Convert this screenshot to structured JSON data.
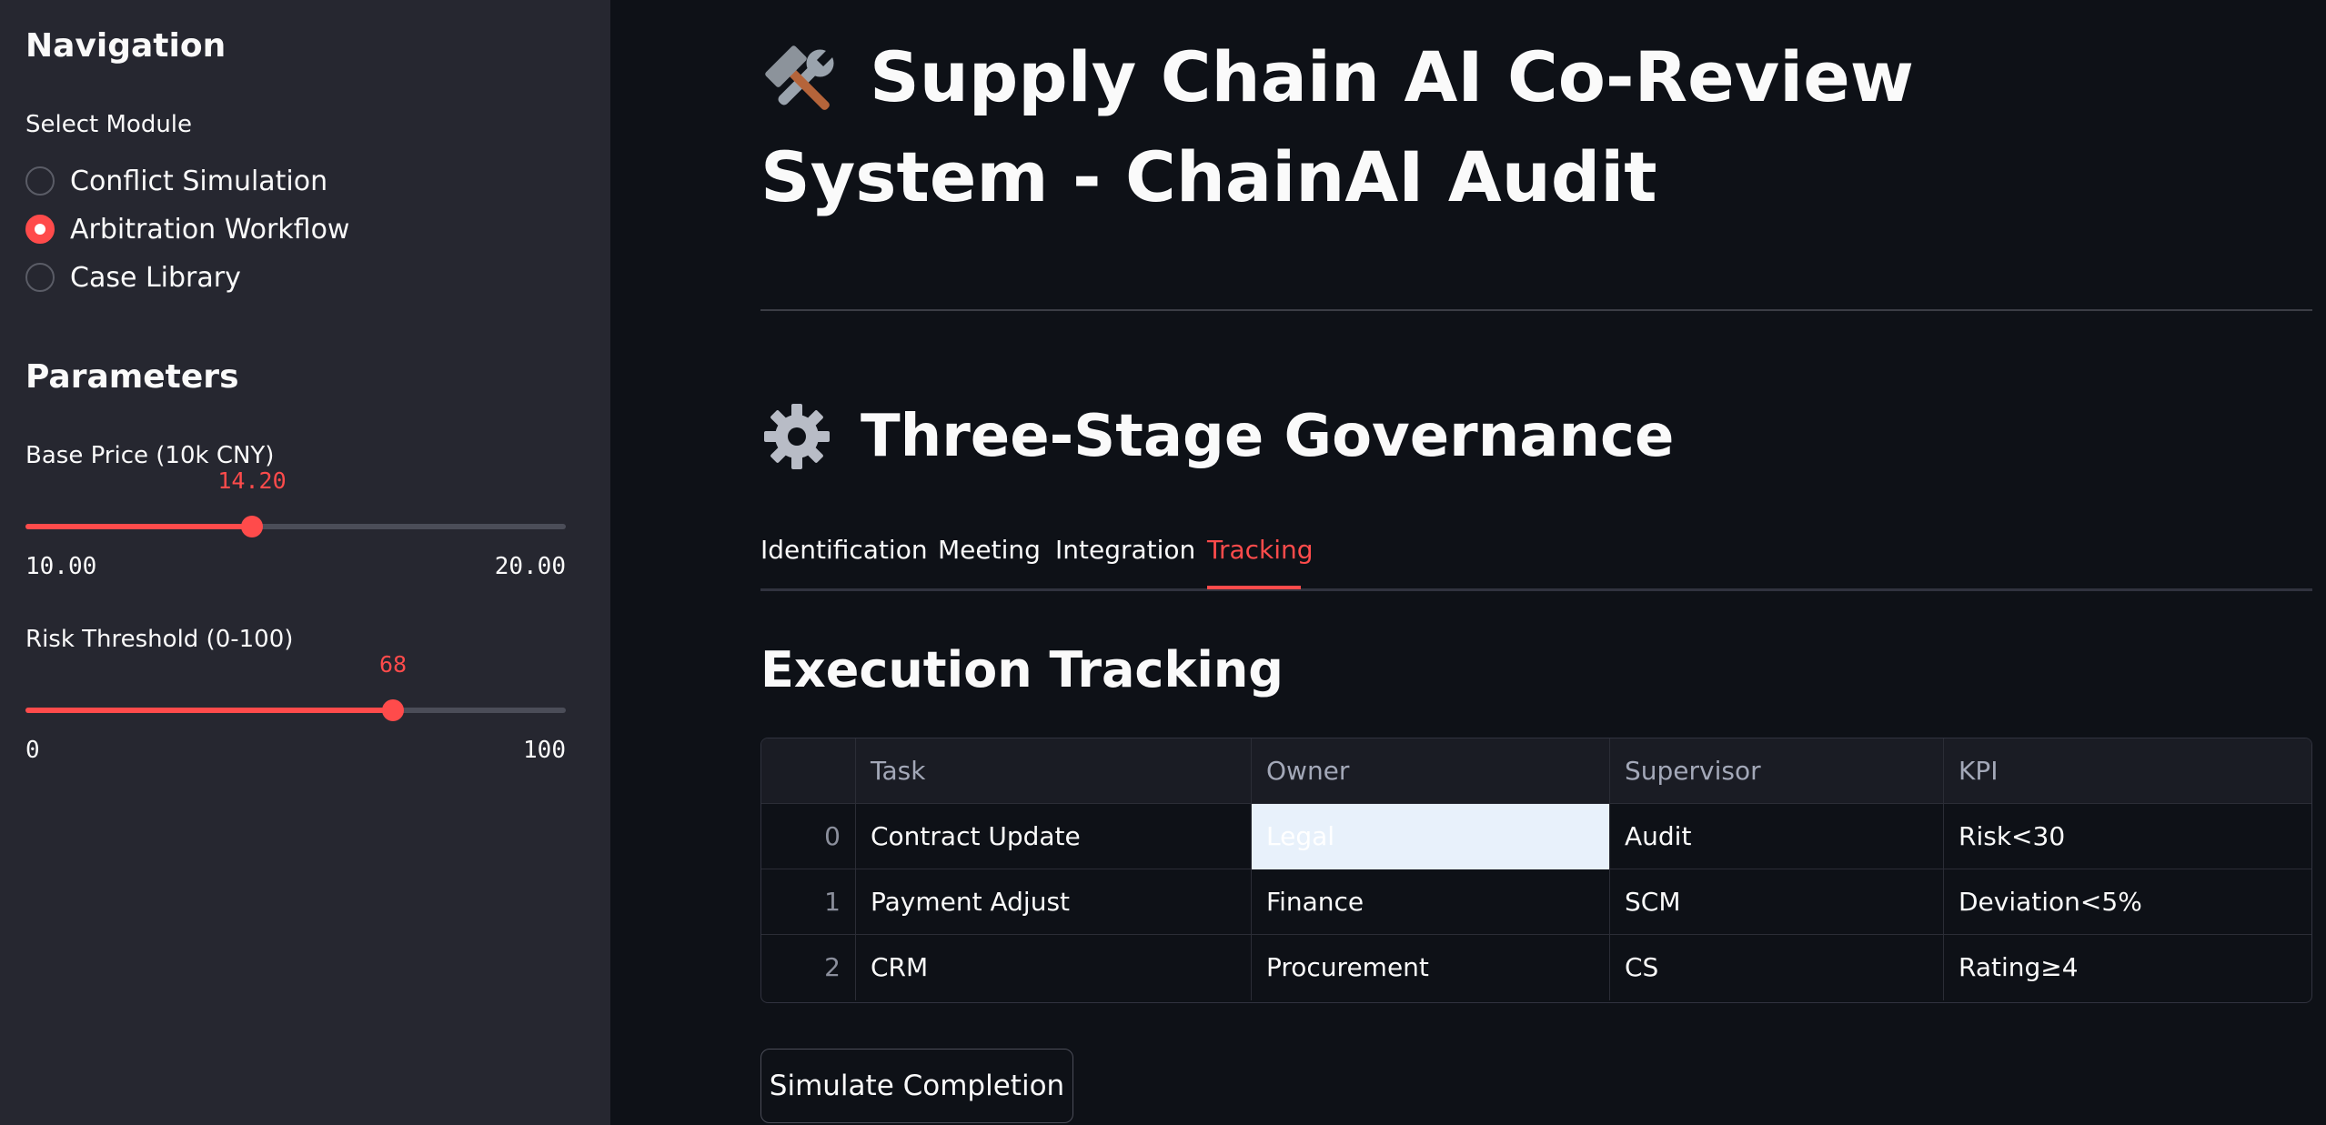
{
  "sidebar": {
    "nav_heading": "Navigation",
    "select_label": "Select Module",
    "modules": [
      {
        "label": "Conflict Simulation",
        "selected": false
      },
      {
        "label": "Arbitration Workflow",
        "selected": true
      },
      {
        "label": "Case Library",
        "selected": false
      }
    ],
    "params_heading": "Parameters",
    "base_price": {
      "label": "Base Price (10k CNY)",
      "value": "14.20",
      "min": "10.00",
      "max": "20.00",
      "fraction": 0.42
    },
    "risk_threshold": {
      "label": "Risk Threshold (0-100)",
      "value": "68",
      "min": "0",
      "max": "100",
      "fraction": 0.68
    }
  },
  "main": {
    "title_icon": "hammer-and-wrench-icon",
    "title": "Supply Chain AI Co-Review System - ChainAI Audit",
    "section_icon": "gear-icon",
    "section_title": "Three-Stage Governance",
    "tabs": [
      {
        "label": "Identification",
        "active": false
      },
      {
        "label": "Meeting",
        "active": false
      },
      {
        "label": "Integration",
        "active": false
      },
      {
        "label": "Tracking",
        "active": true
      }
    ],
    "subsection_title": "Execution Tracking",
    "table": {
      "columns": [
        "",
        "Task",
        "Owner",
        "Supervisor",
        "KPI"
      ],
      "rows": [
        [
          "0",
          "Contract Update",
          "Legal",
          "Audit",
          "Risk<30"
        ],
        [
          "1",
          "Payment Adjust",
          "Finance",
          "SCM",
          "Deviation<5%"
        ],
        [
          "2",
          "CRM",
          "Procurement",
          "CS",
          "Rating≥4"
        ]
      ],
      "selected_cell": {
        "row": 0,
        "col": 2
      }
    },
    "button_label": "Simulate Completion"
  },
  "colors": {
    "accent": "#ff4b4b",
    "background": "#0e1117",
    "sidebar": "#262730"
  }
}
